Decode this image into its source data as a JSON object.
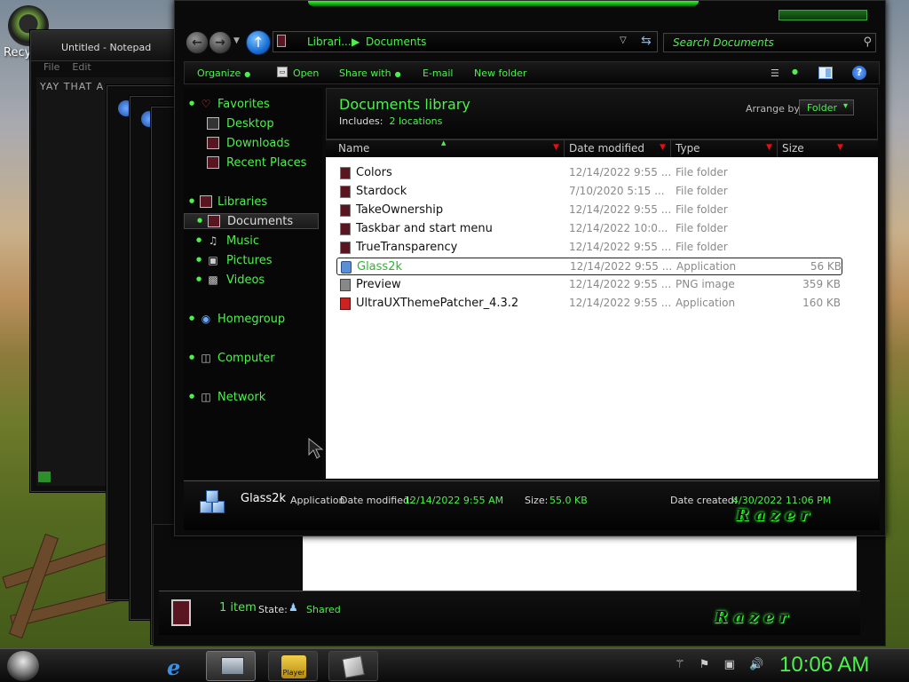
{
  "desktop": {
    "recycle_label": "Recy"
  },
  "notepad": {
    "title": "Untitled - Notepad",
    "menu_file": "File",
    "menu_edit": "Edit",
    "text": "YAY  THAT  A"
  },
  "explorer": {
    "address": {
      "crumbs": [
        "Librari...",
        "Documents"
      ]
    },
    "search": {
      "placeholder": "Search Documents"
    },
    "toolbar": {
      "organize": "Organize",
      "open": "Open",
      "share_with": "Share with",
      "email": "E-mail",
      "new_folder": "New folder"
    },
    "nav": {
      "favorites": "Favorites",
      "desktop": "Desktop",
      "downloads": "Downloads",
      "recent_places": "Recent Places",
      "libraries": "Libraries",
      "documents": "Documents",
      "music": "Music",
      "pictures": "Pictures",
      "videos": "Videos",
      "homegroup": "Homegroup",
      "computer": "Computer",
      "network": "Network"
    },
    "library": {
      "title": "Documents library",
      "includes_label": "Includes:",
      "includes_value": "2 locations",
      "arrange_label": "Arrange by:",
      "arrange_value": "Folder"
    },
    "columns": {
      "name": "Name",
      "date_modified": "Date modified",
      "type": "Type",
      "size": "Size"
    },
    "files": [
      {
        "name": "Colors",
        "date": "12/14/2022 9:55 ...",
        "type": "File folder",
        "size": ""
      },
      {
        "name": "Stardock",
        "date": "7/10/2020 5:15 ...",
        "type": "File folder",
        "size": ""
      },
      {
        "name": "TakeOwnership",
        "date": "12/14/2022 9:55 ...",
        "type": "File folder",
        "size": ""
      },
      {
        "name": "Taskbar and start menu",
        "date": "12/14/2022 10:0...",
        "type": "File folder",
        "size": ""
      },
      {
        "name": "TrueTransparency",
        "date": "12/14/2022 9:55 ...",
        "type": "File folder",
        "size": ""
      },
      {
        "name": "Glass2k",
        "date": "12/14/2022 9:55 ...",
        "type": "Application",
        "size": "56 KB"
      },
      {
        "name": "Preview",
        "date": "12/14/2022 9:55 ...",
        "type": "PNG image",
        "size": "359 KB"
      },
      {
        "name": "UltraUXThemePatcher_4.3.2",
        "date": "12/14/2022 9:55 ...",
        "type": "Application",
        "size": "160 KB"
      }
    ],
    "details": {
      "name": "Glass2k",
      "type": "Application",
      "modified_label": "Date modified:",
      "modified_value": "12/14/2022 9:55 AM",
      "size_label": "Size:",
      "size_value": "55.0 KB",
      "created_label": "Date created:",
      "created_value": "4/30/2022 11:06 PM",
      "logo": "Razer"
    }
  },
  "explorer2": {
    "count": "1 item",
    "state_label": "State:",
    "state_value": "Shared",
    "logo": "Razer"
  },
  "taskbar": {
    "player_label": "Player",
    "clock": "10:06 AM"
  },
  "colors": {
    "accent": "#4ef04e",
    "background": "#0a0a0a"
  }
}
